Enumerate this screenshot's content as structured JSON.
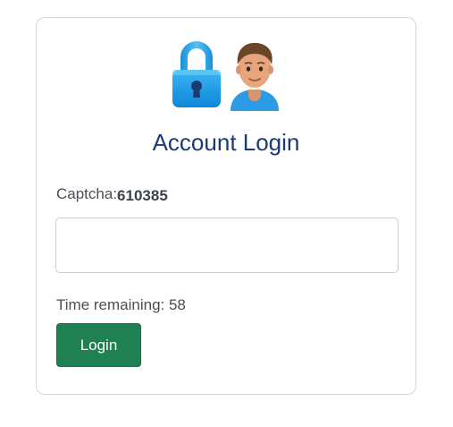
{
  "header": {
    "icons": [
      "lock-icon",
      "person-icon"
    ],
    "title": "Account Login"
  },
  "form": {
    "captcha_label": "Captcha:",
    "captcha_value": "610385",
    "captcha_input_value": "",
    "timer_label": "Time remaining: ",
    "timer_value": "58",
    "login_label": "Login"
  },
  "colors": {
    "title": "#1c3a7a",
    "button": "#1f8152",
    "lock": "#1fa2ea",
    "text": "#4a4f55"
  }
}
